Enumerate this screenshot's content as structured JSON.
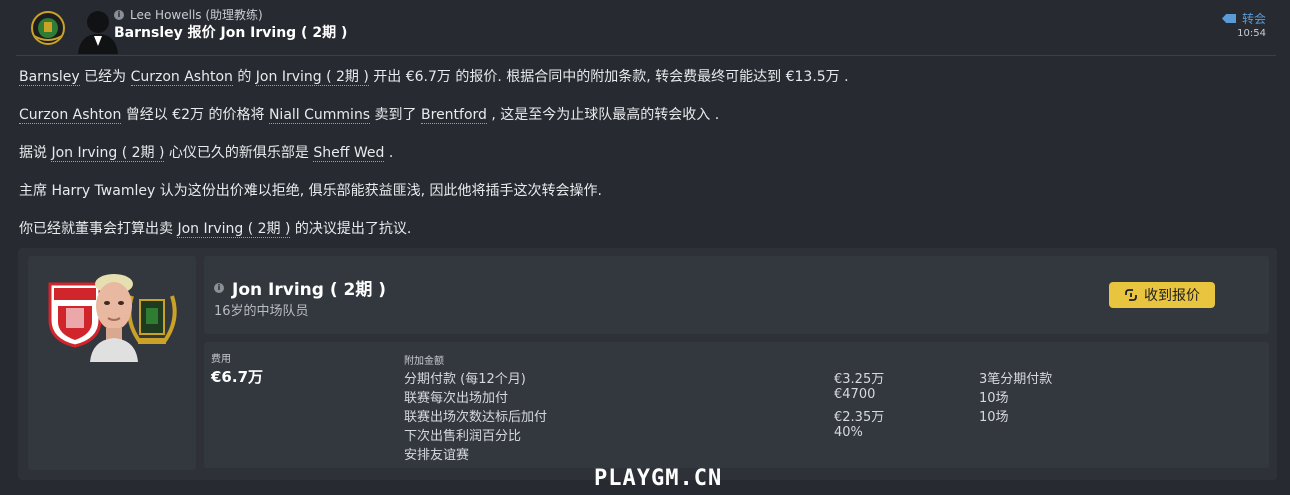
{
  "header": {
    "sender": "Lee Howells (助理教练)",
    "subject": "Barnsley 报价 Jon Irving ( 2期 )",
    "tag": "转会",
    "time": "10:54"
  },
  "paragraphs": {
    "p1": {
      "a": "Barnsley",
      "b": " 已经为 ",
      "c": "Curzon Ashton",
      "d": " 的 ",
      "e": "Jon Irving ( 2期 )",
      "f": " 开出 €6.7万 的报价. 根据合同中的附加条款, 转会费最终可能达到 €13.5万 ."
    },
    "p2": {
      "a": "Curzon Ashton",
      "b": " 曾经以 €2万 的价格将 ",
      "c": "Niall Cummins",
      "d": " 卖到了 ",
      "e": "Brentford",
      "f": " , 这是至今为止球队最高的转会收入 ."
    },
    "p3": {
      "a": "据说 ",
      "b": "Jon Irving ( 2期 )",
      "c": " 心仪已久的新俱乐部是 ",
      "d": "Sheff Wed",
      "e": " ."
    },
    "p4": "主席 Harry Twamley 认为这份出价难以拒绝, 俱乐部能获益匪浅, 因此他将插手这次转会操作.",
    "p5": {
      "a": "你已经就董事会打算出卖 ",
      "b": "Jon Irving ( 2期 )",
      "c": " 的决议提出了抗议."
    }
  },
  "card": {
    "player_name": "Jon Irving ( 2期 )",
    "player_sub": "16岁的中场队员",
    "accept_label": "收到报价",
    "fee_label": "费用",
    "fee_value": "€6.7万",
    "extras_label": "附加金额",
    "extras": [
      {
        "name": "分期付款 (每12个月)",
        "amount": "€3.25万",
        "note": "3笔分期付款"
      },
      {
        "name": "联赛每次出场加付",
        "amount": "€4700",
        "note": "10场"
      },
      {
        "name": "联赛出场次数达标后加付",
        "amount": "€2.35万",
        "note": "10场"
      },
      {
        "name": "下次出售利润百分比",
        "amount": "40%",
        "note": ""
      },
      {
        "name": "安排友谊赛",
        "amount": "",
        "note": ""
      }
    ]
  },
  "watermark": "PLAYGM.CN",
  "colors": {
    "background": "#272a30",
    "accent_button": "#e9c43f",
    "tag_blue": "#5b9bd5",
    "barnsley_red": "#d0252b"
  },
  "icons": [
    "club-crest-icon",
    "manager-silhouette-icon",
    "info-icon",
    "transfer-tag-icon",
    "accept-offer-icon"
  ]
}
